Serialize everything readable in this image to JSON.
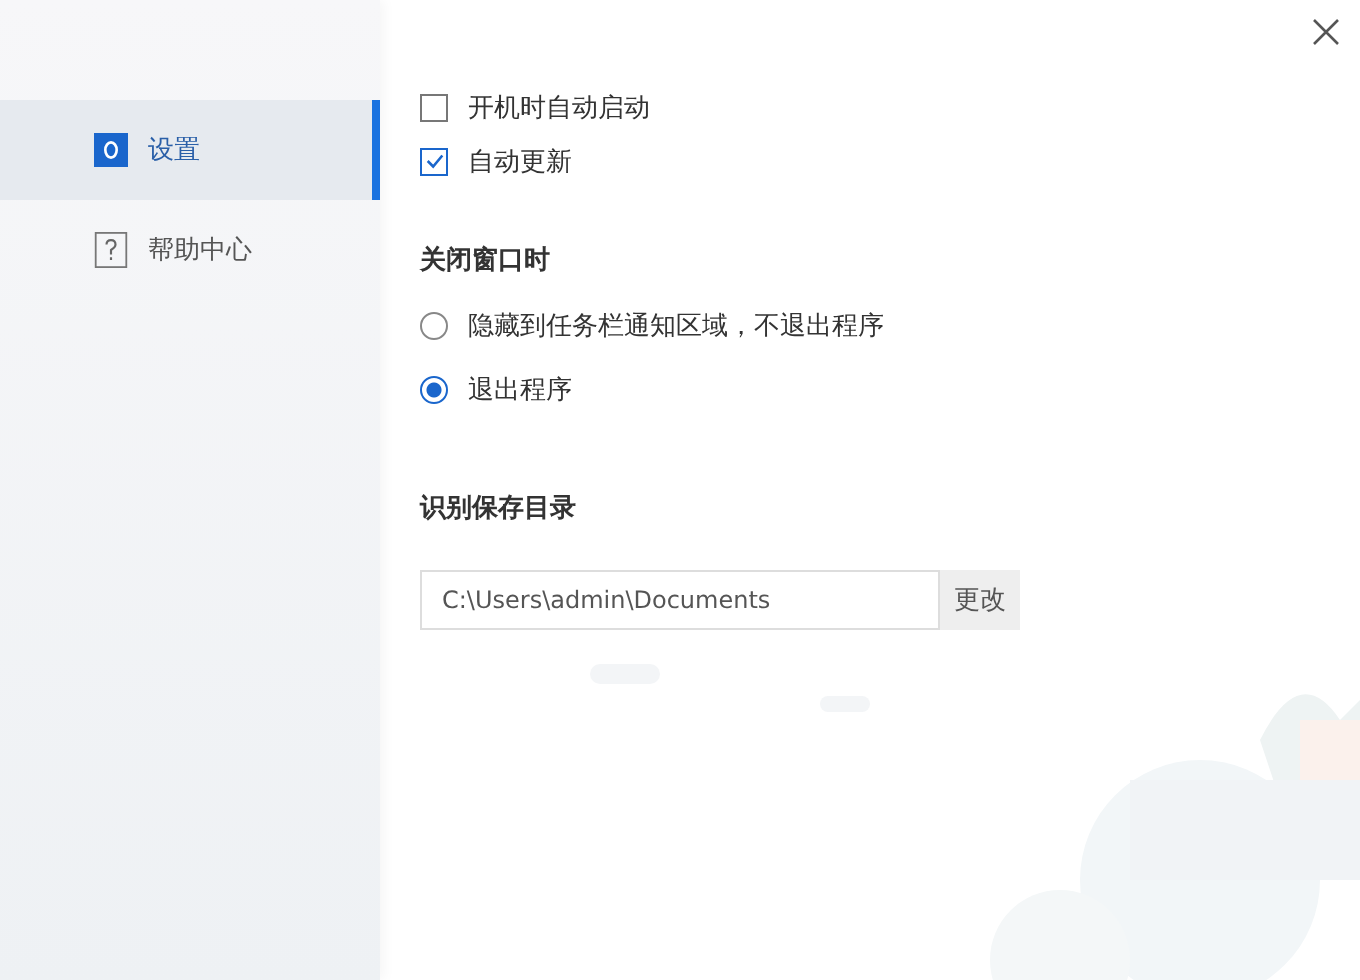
{
  "sidebar": {
    "items": [
      {
        "kind": "settings",
        "label": "设置",
        "selected": true
      },
      {
        "kind": "help",
        "label": "帮助中心",
        "selected": false
      }
    ]
  },
  "options": [
    {
      "label": "开机时自动启动",
      "checked": false
    },
    {
      "label": "自动更新",
      "checked": true
    }
  ],
  "close_window": {
    "heading": "关闭窗口时",
    "choices": [
      {
        "label": "隐藏到任务栏通知区域，不退出程序",
        "selected": false
      },
      {
        "label": "退出程序",
        "selected": true
      }
    ]
  },
  "save_folder": {
    "heading": "识别保存目录",
    "value": "C:\\Users\\admin\\Documents",
    "button": "更改"
  }
}
